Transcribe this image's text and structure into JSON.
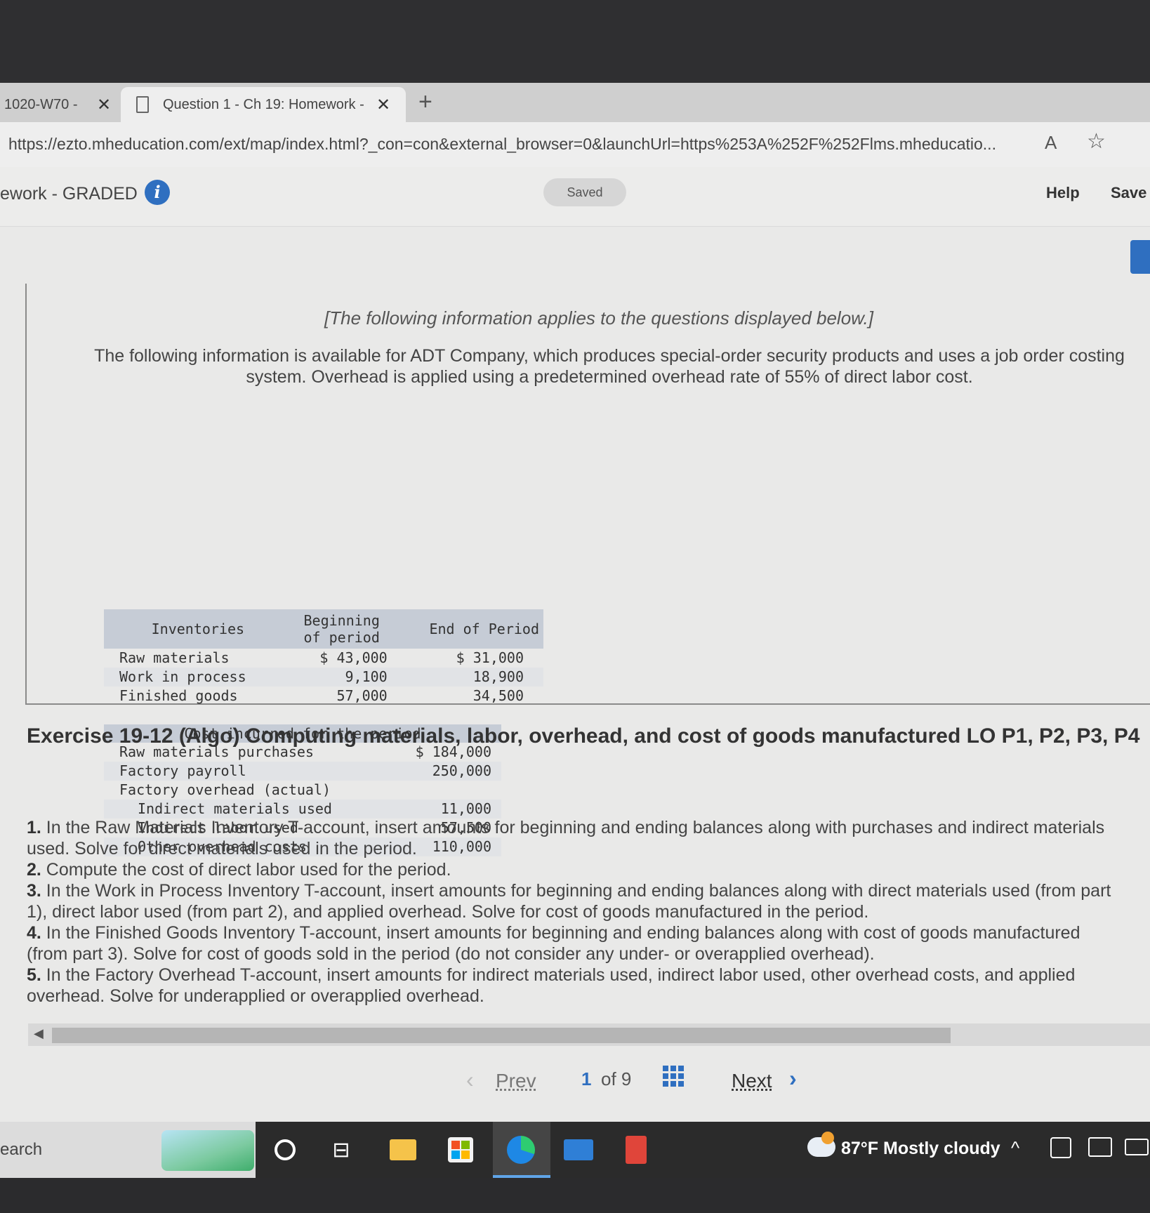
{
  "browser": {
    "tabs": [
      {
        "label": "1020-W70 - ",
        "active": false
      },
      {
        "label": "Question 1 - Ch 19: Homework - ",
        "active": true
      }
    ],
    "new_tab": "+",
    "close_glyph": "✕",
    "url": "https://ezto.mheducation.com/ext/map/index.html?_con=con&external_browser=0&launchUrl=https%253A%252F%252Flms.mheducatio...",
    "read_aloud": "A",
    "favorite_icon": "star-add-icon"
  },
  "header": {
    "assignment_title": "ework - GRADED",
    "info_glyph": "i",
    "saved_status": "Saved",
    "help_label": "Help",
    "save_label": "Save"
  },
  "info": {
    "applies_note": "[The following information applies to the questions displayed below.]",
    "intro": "The following information is available for ADT Company, which produces special-order security products and uses a job order costing system. Overhead is applied using a predetermined overhead rate of 55% of direct labor cost.",
    "inventory_table": {
      "headers": [
        "Inventories",
        "Beginning of period",
        "End of Period"
      ],
      "rows": [
        [
          "Raw materials",
          "$ 43,000",
          "$ 31,000"
        ],
        [
          "Work in process",
          "9,100",
          "18,900"
        ],
        [
          "Finished goods",
          "57,000",
          "34,500"
        ]
      ]
    },
    "cost_table": {
      "header": "Cost incurred for the period",
      "rows": [
        [
          "Raw materials purchases",
          "$ 184,000"
        ],
        [
          "Factory payroll",
          "250,000"
        ],
        [
          "Factory overhead (actual)",
          ""
        ],
        [
          "Indirect materials used",
          "11,000"
        ],
        [
          "Indirect labor used",
          "57,500"
        ],
        [
          "Other overhead costs",
          "110,000"
        ]
      ]
    }
  },
  "exercise": {
    "title": "Exercise 19-12 (Algo) Computing materials, labor, overhead, and cost of goods manufactured LO P1, P2, P3, P4",
    "steps": [
      {
        "num": "1.",
        "text": " In the Raw Materials Inventory T-account, insert amounts for beginning and ending balances along with purchases and indirect materials used. Solve for direct materials used in the period."
      },
      {
        "num": "2.",
        "text": " Compute the cost of direct labor used for the period."
      },
      {
        "num": "3.",
        "text": " In the Work in Process Inventory T-account, insert amounts for beginning and ending balances along with direct materials used (from part 1), direct labor used (from part 2), and applied overhead. Solve for cost of goods manufactured in the period."
      },
      {
        "num": "4.",
        "text": " In the Finished Goods Inventory T-account, insert amounts for beginning and ending balances along with cost of goods manufactured (from part 3). Solve for cost of goods sold in the period (do not consider any under- or overapplied overhead)."
      },
      {
        "num": "5.",
        "text": " In the Factory Overhead T-account, insert amounts for indirect materials used, indirect labor used, other overhead costs, and applied overhead. Solve for underapplied or overapplied overhead."
      }
    ]
  },
  "navigation": {
    "prev_label": "Prev",
    "current_page": "1",
    "of_total": "of 9",
    "next_label": "Next"
  },
  "taskbar": {
    "search_text": "earch",
    "weather": "87°F  Mostly cloudy"
  },
  "colors": {
    "accent": "#2f6fc0",
    "table_header": "#c6ccd6",
    "table_stripe": "#e1e3e6"
  }
}
